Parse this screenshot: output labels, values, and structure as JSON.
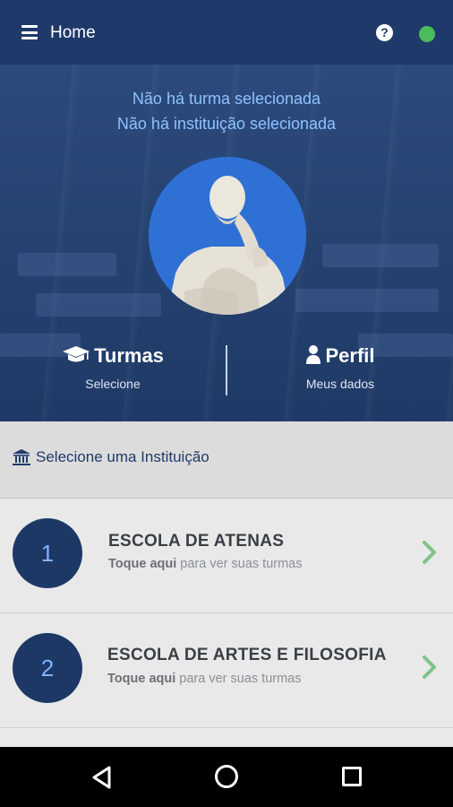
{
  "app_bar": {
    "title": "Home",
    "help_icon": "question-circle-icon",
    "status_color": "#4cbb5c"
  },
  "hero": {
    "no_class_text": "Não há turma selecionada",
    "no_institution_text": "Não há instituição selecionada",
    "turmas": {
      "icon": "graduation-cap-icon",
      "title": "Turmas",
      "subtitle": "Selecione"
    },
    "perfil": {
      "icon": "user-icon",
      "title": "Perfil",
      "subtitle": "Meus dados"
    }
  },
  "institution_header": {
    "icon": "institution-icon",
    "label": "Selecione uma Instituição"
  },
  "schools": [
    {
      "number": "1",
      "name": "ESCOLA DE ATENAS",
      "hint_bold": "Toque aqui",
      "hint_rest": " para ver suas turmas"
    },
    {
      "number": "2",
      "name": "ESCOLA DE ARTES E FILOSOFIA",
      "hint_bold": "Toque aqui",
      "hint_rest": " para ver suas turmas"
    }
  ],
  "colors": {
    "primary": "#1f3a6a",
    "accent_text": "#8ec3ff",
    "chevron": "#7fc28a"
  }
}
